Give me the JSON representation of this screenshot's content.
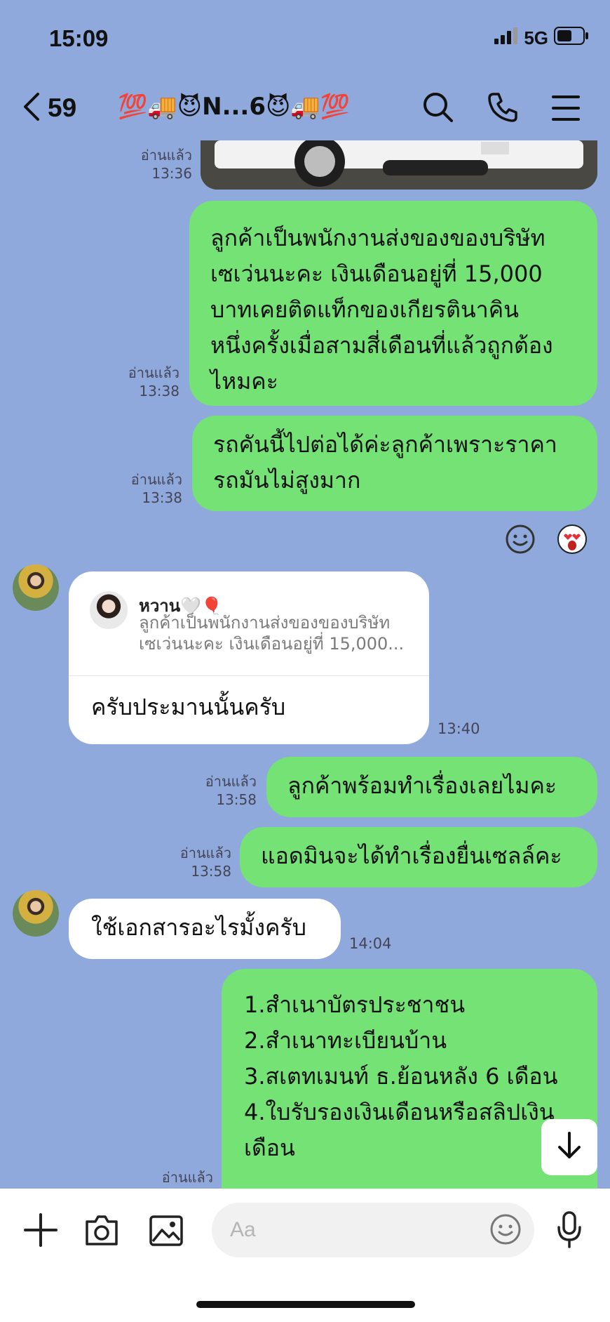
{
  "status_bar": {
    "time": "15:09",
    "network": "5G"
  },
  "header": {
    "back_count": "59",
    "title": "💯🚚😈N...6😈🚚💯"
  },
  "messages": [
    {
      "read": "อ่านแล้ว",
      "time": "13:36"
    },
    {
      "read": "อ่านแล้ว",
      "time": "13:38",
      "lines": [
        "ลูกค้าเป็นพนักงานส่งของของบริษัท",
        "เซเว่นนะคะ เงินเดือนอยู่ที่ 15,000",
        "บาทเคยติดแท็กของเกียรตินาคิน",
        "หนึ่งครั้งเมื่อสามสี่เดือนที่แล้วถูกต้อง",
        "ไหมคะ"
      ]
    },
    {
      "read": "อ่านแล้ว",
      "time": "13:38",
      "lines": [
        "รถคันนี้ไปต่อได้ค่ะลูกค้าเพราะราคา",
        "รถมันไม่สูงมาก"
      ]
    },
    {
      "time": "13:40",
      "reply_name": "หวาน🤍🎈",
      "reply_lines": [
        "ลูกค้าเป็นพนักงานส่งของของบริษัท",
        "เซเว่นนะคะ เงินเดือนอยู่ที่ 15,000..."
      ],
      "text": "ครับประมานนั้นครับ"
    },
    {
      "read": "อ่านแล้ว",
      "time": "13:58",
      "text": "ลูกค้าพร้อมทำเรื่องเลยไมคะ"
    },
    {
      "read": "อ่านแล้ว",
      "time": "13:58",
      "text": "แอดมินจะได้ทำเรื่องยื่นเซลล์คะ"
    },
    {
      "time": "14:04",
      "text": "ใช้เอกสารอะไรมั้งครับ"
    },
    {
      "read": "อ่านแล้ว",
      "lines": [
        "1.สำเนาบัตรประชาชน",
        "2.สำเนาทะเบียนบ้าน",
        "3.สเตทเมนท์ ธ.ย้อนหลัง 6 เดือน",
        "4.ใบรับรองเงินเดือนหรือสลิปเงิน",
        "เดือน"
      ]
    }
  ],
  "input": {
    "placeholder": "Aa"
  },
  "colors": {
    "background": "#8fa9dc",
    "outgoing_bubble": "#74e275",
    "incoming_bubble": "#ffffff"
  },
  "icons": [
    "signal-icon",
    "battery-icon",
    "back-chevron-icon",
    "search-icon",
    "phone-icon",
    "menu-icon",
    "smile-reaction-icon",
    "heart-eyes-reaction-icon",
    "scroll-down-icon",
    "plus-icon",
    "camera-icon",
    "image-icon",
    "emoji-icon",
    "microphone-icon"
  ]
}
